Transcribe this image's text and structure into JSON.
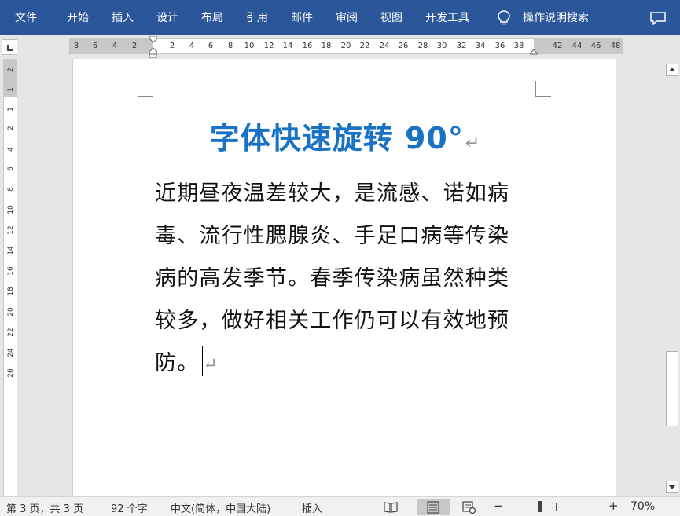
{
  "ribbon": {
    "tabs": [
      "文件",
      "开始",
      "插入",
      "设计",
      "布局",
      "引用",
      "邮件",
      "审阅",
      "视图",
      "开发工具"
    ],
    "tell_me": "操作说明搜索",
    "tell_me_icon": "lightbulb-icon",
    "comment_icon": "comment-icon",
    "bg_color": "#2b579a"
  },
  "ruler": {
    "left_numbers": [
      "8",
      "6",
      "4",
      "2"
    ],
    "numbers": [
      "2",
      "4",
      "6",
      "8",
      "10",
      "12",
      "14",
      "16",
      "18",
      "20",
      "22",
      "24",
      "26",
      "28",
      "30",
      "32",
      "34",
      "36",
      "38"
    ],
    "right_numbers": [
      "42",
      "44",
      "46",
      "48"
    ],
    "vertical_numbers": [
      "2",
      "1",
      "1",
      "2",
      "4",
      "6",
      "8",
      "10",
      "12",
      "14",
      "16",
      "18",
      "20",
      "22",
      "24",
      "26"
    ]
  },
  "document": {
    "title": "字体快速旋转 90°",
    "title_color": "#1a72c4",
    "body_lines": [
      "近期昼夜温差较大，是流感、诺如病",
      "毒、流行性腮腺炎、手足口病等传染",
      "病的高发季节。春季传染病虽然种类",
      "较多，做好相关工作仍可以有效地预",
      "防。"
    ],
    "paragraph_mark": "↵"
  },
  "status": {
    "page_info": "第 3 页，共 3 页",
    "word_count": "92 个字",
    "language": "中文(简体，中国大陆)",
    "mode": "插入",
    "zoom_minus": "−",
    "zoom_plus": "+",
    "zoom_level": "70%"
  }
}
